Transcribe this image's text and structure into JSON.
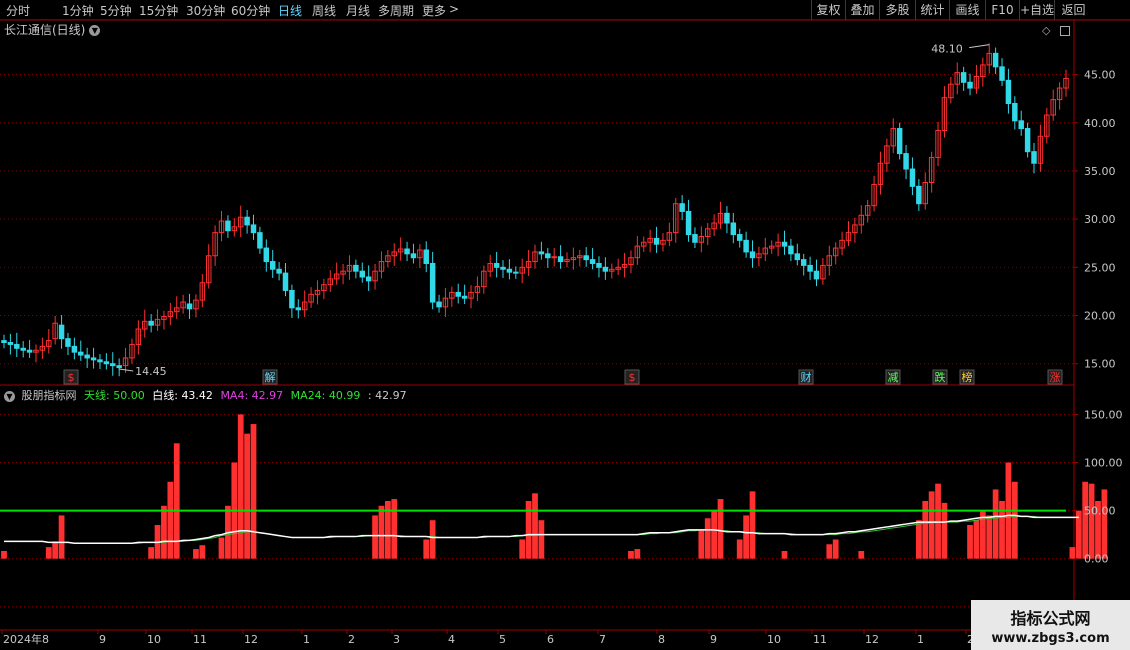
{
  "toolbar": {
    "periods": [
      "分时",
      "1分钟",
      "5分钟",
      "15分钟",
      "30分钟",
      "60分钟",
      "日线",
      "周线",
      "月线",
      "多周期",
      "更多"
    ],
    "active_period": "日线",
    "more_arrow": ">",
    "right_buttons": [
      "复权",
      "叠加",
      "多股",
      "统计",
      "画线",
      "F10",
      "+自选",
      "返回"
    ]
  },
  "main_chart": {
    "title": "长江通信(日线)",
    "title_icon": "chevron-down-icon",
    "high_label": "48.10",
    "low_label": "14.45",
    "y_ticks": [
      "45.00",
      "40.00",
      "35.00",
      "30.00",
      "25.00",
      "20.00",
      "15.00"
    ],
    "event_markers": [
      {
        "label": "$",
        "color": "#ff3030"
      },
      {
        "label": "解",
        "color": "#5fd7ff"
      },
      {
        "label": "$",
        "color": "#ff3030"
      },
      {
        "label": "财",
        "color": "#5fd7ff"
      },
      {
        "label": "减",
        "color": "#5fff5f"
      },
      {
        "label": "跌",
        "color": "#5fff5f"
      },
      {
        "label": "榜",
        "color": "#ffcf30"
      },
      {
        "label": "涨",
        "color": "#ff3030"
      }
    ]
  },
  "indicator": {
    "name": "股朋指标网",
    "tianxian_label": "天线:",
    "tianxian_value": "50.00",
    "baixian_label": "白线:",
    "baixian_value": "43.42",
    "ma4_label": "MA4:",
    "ma4_value": "42.97",
    "ma24_label": "MA24:",
    "ma24_value": "40.99",
    "last_value": ": 42.97",
    "y_ticks": [
      "150.00",
      "100.00",
      "50.00",
      "0.00",
      "-50.00"
    ]
  },
  "x_axis": [
    "2024年8",
    "9",
    "10",
    "11",
    "12",
    "1",
    "2",
    "3",
    "4",
    "5",
    "6",
    "7",
    "8",
    "9",
    "10",
    "11",
    "12",
    "1",
    "2"
  ],
  "watermark": {
    "line1": "指标公式网",
    "line2": "www.zbgs3.com"
  },
  "colors": {
    "up": "#ff3030",
    "down": "#30d8e8",
    "grid": "#8a0000",
    "axis": "#a00000",
    "tianxian": "#00e000",
    "baixian": "#ffffff"
  },
  "chart_data": {
    "type": "candlestick",
    "price_ylim": [
      13,
      49
    ],
    "indicator_ylim": [
      -70,
      165
    ],
    "tianxian": 50,
    "close": [
      17.2,
      17.0,
      16.6,
      16.4,
      16.2,
      16.4,
      16.8,
      17.4,
      19.2,
      17.6,
      16.8,
      16.2,
      15.9,
      15.6,
      15.4,
      15.2,
      15.0,
      14.8,
      14.6,
      15.6,
      17.0,
      18.6,
      19.4,
      19.0,
      19.6,
      19.9,
      20.4,
      20.8,
      21.4,
      20.7,
      21.6,
      23.4,
      26.2,
      28.6,
      29.8,
      28.8,
      29.2,
      30.2,
      29.4,
      28.6,
      27.0,
      25.6,
      24.8,
      24.4,
      22.6,
      20.8,
      20.6,
      21.4,
      22.2,
      22.6,
      23.2,
      23.8,
      24.3,
      24.6,
      25.2,
      24.6,
      24.0,
      23.6,
      24.6,
      25.6,
      26.2,
      26.6,
      26.9,
      26.4,
      26.0,
      26.8,
      25.4,
      21.4,
      20.9,
      21.8,
      22.4,
      22.0,
      21.8,
      22.4,
      23.0,
      24.6,
      25.4,
      25.0,
      24.8,
      24.5,
      24.4,
      25.0,
      25.6,
      26.6,
      26.4,
      26.0,
      26.1,
      25.6,
      25.8,
      26.0,
      26.2,
      25.8,
      25.4,
      25.0,
      24.6,
      24.8,
      25.0,
      25.3,
      26.0,
      27.2,
      27.6,
      28.0,
      27.4,
      27.8,
      28.6,
      31.6,
      30.8,
      28.4,
      27.6,
      28.2,
      29.0,
      29.6,
      30.6,
      29.6,
      28.4,
      27.8,
      26.6,
      26.0,
      26.4,
      27.0,
      27.2,
      27.6,
      27.2,
      26.4,
      25.8,
      25.2,
      24.6,
      23.8,
      25.2,
      26.2,
      27.0,
      27.8,
      28.6,
      29.4,
      30.4,
      31.4,
      33.6,
      35.8,
      37.6,
      39.4,
      36.8,
      35.2,
      33.4,
      31.6,
      33.8,
      36.4,
      39.2,
      42.6,
      44.0,
      45.2,
      44.2,
      43.6,
      44.8,
      46.0,
      47.2,
      45.8,
      44.4,
      42.0,
      40.2,
      39.4,
      37.0,
      35.8,
      38.6,
      40.8,
      42.4,
      43.6,
      44.6
    ],
    "open": [
      17.4,
      17.2,
      17.0,
      16.6,
      16.4,
      16.2,
      16.4,
      16.8,
      17.6,
      19.0,
      17.6,
      16.8,
      16.2,
      15.9,
      15.6,
      15.4,
      15.2,
      15.0,
      14.8,
      14.8,
      15.6,
      17.0,
      18.6,
      19.4,
      19.0,
      19.6,
      19.9,
      20.4,
      20.8,
      21.2,
      20.7,
      21.6,
      23.4,
      26.2,
      28.6,
      29.8,
      28.8,
      29.2,
      30.2,
      29.4,
      28.6,
      27.0,
      25.6,
      24.8,
      24.4,
      22.6,
      20.8,
      20.6,
      21.4,
      22.2,
      22.6,
      23.2,
      23.8,
      24.3,
      24.6,
      25.2,
      24.6,
      24.0,
      23.6,
      24.6,
      25.6,
      26.2,
      26.6,
      26.9,
      26.4,
      26.0,
      26.8,
      25.4,
      21.4,
      20.9,
      21.8,
      22.4,
      22.0,
      21.8,
      22.4,
      23.0,
      24.6,
      25.4,
      25.0,
      24.8,
      24.5,
      24.4,
      25.0,
      25.6,
      26.6,
      26.4,
      26.0,
      26.1,
      25.6,
      25.8,
      26.0,
      26.2,
      25.8,
      25.4,
      25.0,
      24.6,
      24.8,
      25.0,
      25.3,
      26.0,
      27.2,
      27.6,
      28.0,
      27.4,
      27.8,
      28.6,
      31.6,
      30.8,
      28.4,
      27.6,
      28.2,
      29.0,
      29.6,
      30.6,
      29.6,
      28.4,
      27.8,
      26.6,
      26.0,
      26.4,
      27.0,
      27.2,
      27.6,
      27.2,
      26.4,
      25.8,
      25.2,
      24.6,
      23.8,
      25.2,
      26.2,
      27.0,
      27.8,
      28.6,
      29.4,
      30.4,
      31.4,
      33.6,
      35.8,
      37.6,
      39.4,
      36.8,
      35.2,
      33.4,
      31.6,
      33.8,
      36.4,
      39.2,
      42.6,
      44.0,
      45.2,
      44.2,
      43.6,
      44.8,
      46.0,
      47.2,
      45.8,
      44.4,
      42.0,
      40.2,
      39.4,
      37.0,
      35.8,
      38.6,
      40.8,
      42.4,
      43.6
    ],
    "indicator_bars": [
      8,
      0,
      0,
      0,
      0,
      0,
      0,
      12,
      18,
      45,
      0,
      0,
      0,
      0,
      0,
      0,
      0,
      0,
      0,
      0,
      0,
      0,
      0,
      12,
      35,
      55,
      80,
      120,
      0,
      0,
      10,
      14,
      0,
      0,
      22,
      55,
      100,
      150,
      130,
      140,
      0,
      0,
      0,
      0,
      0,
      0,
      0,
      0,
      0,
      0,
      0,
      0,
      0,
      0,
      0,
      0,
      0,
      0,
      45,
      55,
      60,
      62,
      0,
      0,
      0,
      0,
      20,
      40,
      0,
      0,
      0,
      0,
      0,
      0,
      0,
      0,
      0,
      0,
      0,
      0,
      0,
      20,
      60,
      68,
      40,
      0,
      0,
      0,
      0,
      0,
      0,
      0,
      0,
      0,
      0,
      0,
      0,
      0,
      8,
      10,
      0,
      0,
      0,
      0,
      0,
      0,
      0,
      0,
      0,
      30,
      42,
      50,
      62,
      0,
      0,
      20,
      45,
      70,
      0,
      0,
      0,
      0,
      8,
      0,
      0,
      0,
      0,
      0,
      0,
      15,
      20,
      0,
      0,
      0,
      8,
      0,
      0,
      0,
      0,
      0,
      0,
      0,
      0,
      40,
      60,
      70,
      78,
      58,
      0,
      0,
      0,
      35,
      40,
      50,
      45,
      72,
      60,
      100,
      80,
      0,
      0,
      0,
      0,
      0,
      0,
      0,
      0,
      12,
      50,
      80,
      78,
      60,
      72,
      0,
      0,
      0,
      0,
      0,
      0,
      0,
      0,
      20,
      30,
      40
    ],
    "baixian": [
      18,
      18,
      18,
      18,
      18,
      18,
      18,
      17,
      17,
      17,
      17,
      16,
      16,
      16,
      16,
      16,
      16,
      16,
      16,
      16,
      16,
      17,
      17,
      17,
      17,
      18,
      18,
      18,
      19,
      19,
      20,
      21,
      22,
      24,
      25,
      27,
      28,
      29,
      29,
      28,
      27,
      26,
      25,
      24,
      23,
      22,
      22,
      22,
      22,
      22,
      22,
      23,
      23,
      23,
      23,
      23,
      24,
      24,
      24,
      24,
      24,
      24,
      23,
      23,
      23,
      23,
      23,
      22,
      22,
      22,
      22,
      22,
      22,
      22,
      22,
      23,
      23,
      23,
      23,
      23,
      24,
      24,
      25,
      25,
      25,
      25,
      25,
      25,
      25,
      25,
      25,
      25,
      25,
      25,
      25,
      25,
      25,
      25,
      25,
      25,
      26,
      27,
      27,
      27,
      27,
      28,
      29,
      30,
      30,
      30,
      30,
      30,
      29,
      28,
      28,
      28,
      27,
      27,
      26,
      26,
      26,
      26,
      26,
      25,
      25,
      25,
      25,
      25,
      25,
      26,
      26,
      27,
      28,
      28,
      29,
      30,
      31,
      32,
      33,
      34,
      35,
      36,
      37,
      38,
      38,
      38,
      38,
      38,
      39,
      39,
      40,
      41,
      42,
      43,
      43,
      44,
      44,
      45,
      45,
      44,
      44,
      43,
      43,
      43,
      43,
      43,
      43,
      43,
      43
    ],
    "ma4": [
      18,
      18,
      18,
      18,
      18,
      18,
      18,
      17,
      17,
      17,
      17,
      16,
      16,
      16,
      16,
      16,
      16,
      16,
      16,
      16,
      16,
      16,
      17,
      17,
      17,
      17,
      18,
      18,
      18,
      19,
      19,
      20,
      21,
      22,
      24,
      25,
      26,
      27,
      28,
      28,
      27,
      26,
      25,
      24,
      23,
      22,
      22,
      22,
      22,
      22,
      22,
      22,
      23,
      23,
      23,
      23,
      23,
      24,
      24,
      24,
      24,
      24,
      24,
      23,
      23,
      23,
      23,
      23,
      22,
      22,
      22,
      22,
      22,
      22,
      22,
      22,
      23,
      23,
      23,
      23,
      23,
      24,
      24,
      24,
      25,
      25,
      25,
      25,
      25,
      25,
      25,
      25,
      25,
      25,
      25,
      25,
      25,
      25,
      25,
      25,
      25,
      26,
      26,
      27,
      27,
      27,
      28,
      29,
      29,
      30,
      30,
      30,
      29,
      29,
      28,
      28,
      28,
      27,
      27,
      26,
      26,
      26,
      26,
      26,
      25,
      25,
      25,
      25,
      25,
      25,
      25,
      26,
      26,
      27,
      28,
      28,
      29,
      30,
      31,
      32,
      33,
      34,
      35,
      36,
      37,
      37,
      38,
      38,
      38,
      38,
      39,
      39,
      40,
      41,
      42,
      42,
      43,
      43,
      44,
      44,
      44,
      44,
      43,
      43,
      43,
      43,
      43,
      43,
      43
    ]
  }
}
